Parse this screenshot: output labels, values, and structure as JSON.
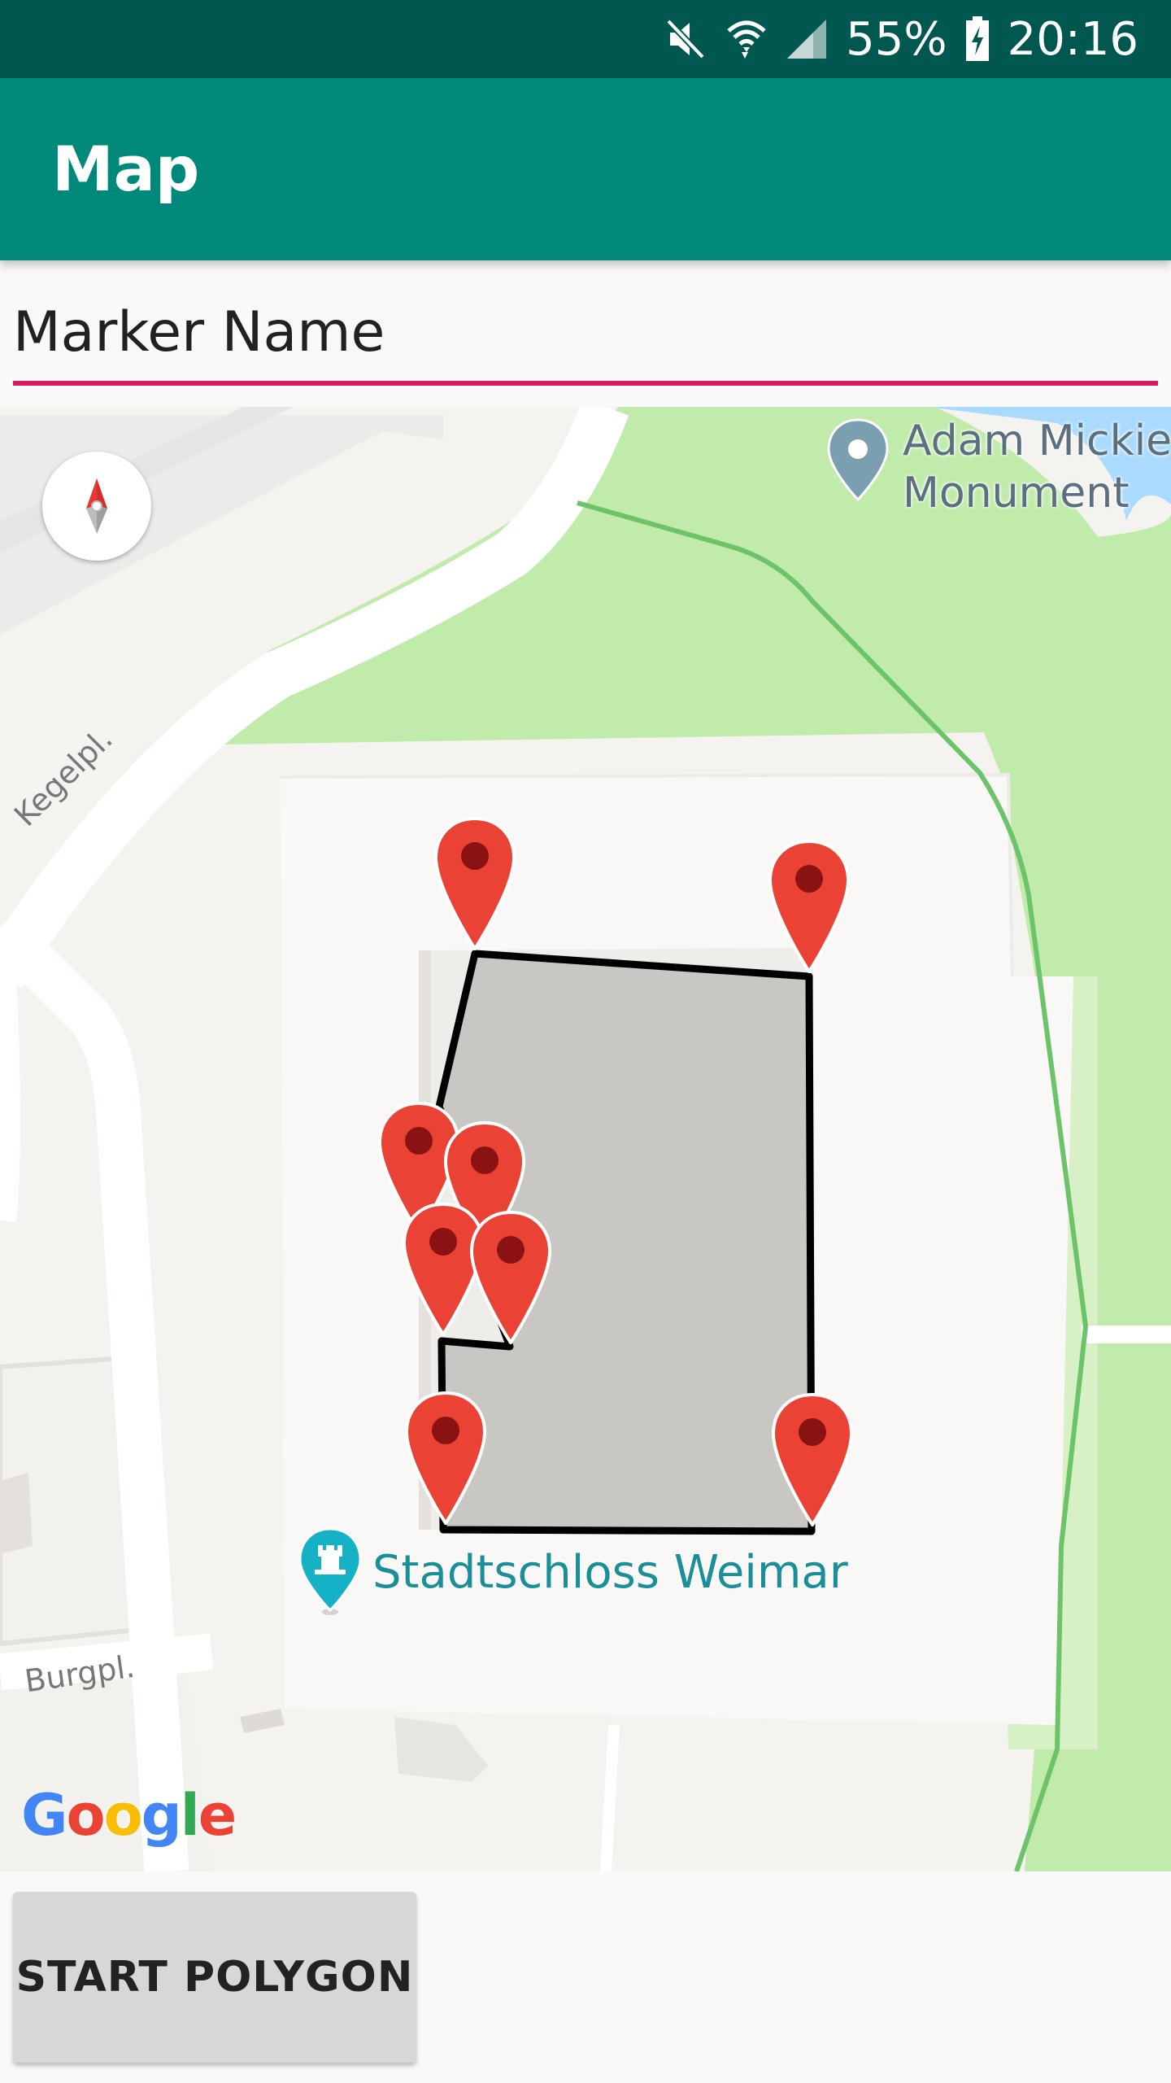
{
  "status_bar": {
    "battery": "55%",
    "time": "20:16",
    "icons": [
      "mute-icon",
      "wifi-icon",
      "signal-icon",
      "battery-charging-icon"
    ]
  },
  "app_bar": {
    "title": "Map"
  },
  "marker_input": {
    "placeholder": "Marker Name",
    "value": ""
  },
  "map": {
    "labels": {
      "monument_line1": "Adam Mickiew",
      "monument_line2": "Monument",
      "street_kegel": "Kegelpl.",
      "street_burg": "Burgpl.",
      "schloss": "Stadtschloss Weimar"
    },
    "google_logo": [
      "G",
      "o",
      "o",
      "g",
      "l",
      "e"
    ],
    "google_colors": [
      "#4285F4",
      "#EA4335",
      "#FBBC05",
      "#4285F4",
      "#34A853",
      "#EA4335"
    ],
    "marker_color": "#ea4335",
    "polygon_fill": "#c9c7c4"
  },
  "start_button": {
    "label": "START POLYGON"
  }
}
